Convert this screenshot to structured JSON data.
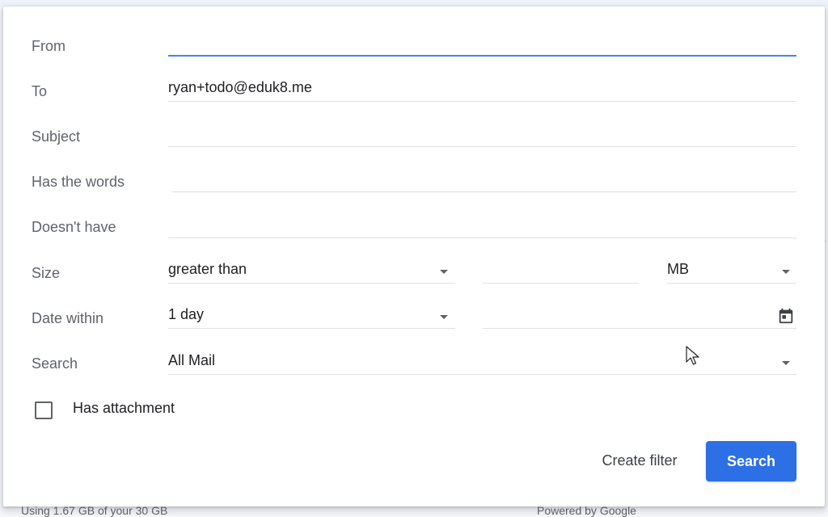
{
  "background": {
    "footer_left": "Using 1.67 GB of your 30 GB",
    "footer_right": "Powered by Google"
  },
  "form": {
    "from": {
      "label": "From",
      "value": ""
    },
    "to": {
      "label": "To",
      "value": "ryan+todo@eduk8.me"
    },
    "subject": {
      "label": "Subject",
      "value": ""
    },
    "has_words": {
      "label": "Has the words",
      "value": ""
    },
    "doesnt_have": {
      "label": "Doesn't have",
      "value": ""
    },
    "size": {
      "label": "Size",
      "operator": "greater than",
      "amount": "",
      "unit": "MB"
    },
    "date_within": {
      "label": "Date within",
      "range": "1 day",
      "date": ""
    },
    "search": {
      "label": "Search",
      "scope": "All Mail"
    },
    "has_attachment": {
      "label": "Has attachment",
      "checked": false
    }
  },
  "actions": {
    "create_filter": "Create filter",
    "search": "Search"
  },
  "colors": {
    "accent": "#4285f4",
    "primary_button": "#2d6fe4"
  }
}
